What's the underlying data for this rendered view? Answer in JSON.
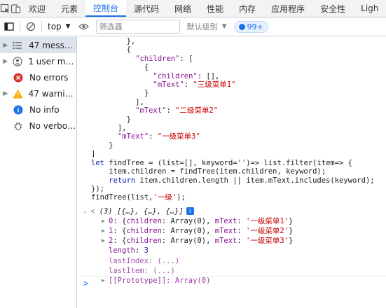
{
  "tabs": [
    "欢迎",
    "元素",
    "控制台",
    "源代码",
    "网络",
    "性能",
    "内存",
    "应用程序",
    "安全性",
    "Ligh"
  ],
  "toolbar": {
    "context": "top",
    "filter_placeholder": "筛选器",
    "level": "默认级别",
    "issues_count": "99+"
  },
  "sidebar": [
    {
      "label": "47 messa...",
      "icon": "list-icon",
      "expandable": true,
      "selected": true
    },
    {
      "label": "1 user me...",
      "icon": "user-icon",
      "expandable": true,
      "selected": false
    },
    {
      "label": "No errors",
      "icon": "error-icon",
      "expandable": false,
      "selected": false
    },
    {
      "label": "47 warnin...",
      "icon": "warning-icon",
      "expandable": true,
      "selected": false
    },
    {
      "label": "No info",
      "icon": "info-icon",
      "expandable": false,
      "selected": false
    },
    {
      "label": "No verbose",
      "icon": "bug-icon",
      "expandable": false,
      "selected": false
    }
  ],
  "code_lines": [
    "        },",
    "        {",
    "          \"children\": [",
    "            {",
    "              \"children\": [],",
    "              \"mText\": \"三级菜单1\"",
    "            }",
    "          ],",
    "          \"mText\": \"二级菜单2\"",
    "        }",
    "      ],",
    "      \"mText\": \"一级菜单3\"",
    "    }",
    "]",
    "let findTree = (list=[], keyword='')=> list.filter(item=> {",
    "    item.children = findTree(item.children, keyword);",
    "    return item.children.length || item.mText.includes(keyword);",
    "});",
    "findTree(list,'一级');"
  ],
  "result": {
    "summary": "(3) [{…}, {…}, {…}]",
    "items": [
      {
        "key": "0",
        "text": "{children: Array(0), mText: '一级菜单1'}"
      },
      {
        "key": "1",
        "text": "{children: Array(0), mText: '一级菜单2'}"
      },
      {
        "key": "2",
        "text": "{children: Array(0), mText: '一级菜单3'}"
      }
    ],
    "length_key": "length",
    "length_value": "3",
    "last_index": "lastIndex: (...)",
    "last_item": "lastItem: (...)",
    "prototype": "[[Prototype]]: Array(0)"
  },
  "prompt": ">"
}
